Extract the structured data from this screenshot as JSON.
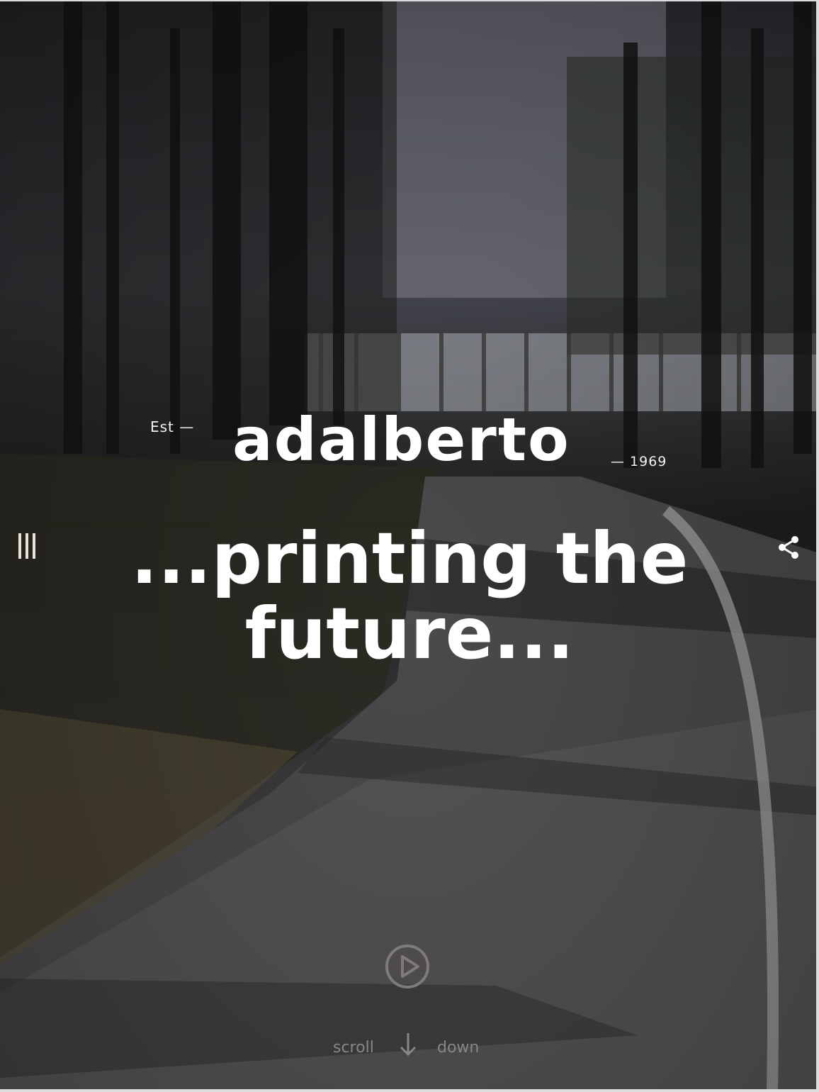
{
  "hero": {
    "est_label": "Est —",
    "brand": "adalberto",
    "year_label": "— 1969",
    "tagline": "...printing the future..."
  },
  "icons": {
    "menu": "menu-icon",
    "share": "share-icon",
    "play": "play-icon",
    "scroll": "arrow-down-icon"
  },
  "scroll": {
    "left": "scroll",
    "right": "down"
  },
  "colors": {
    "text": "#ffffff",
    "menu_bars": "#e8e2d9",
    "muted": "#8a8685"
  }
}
